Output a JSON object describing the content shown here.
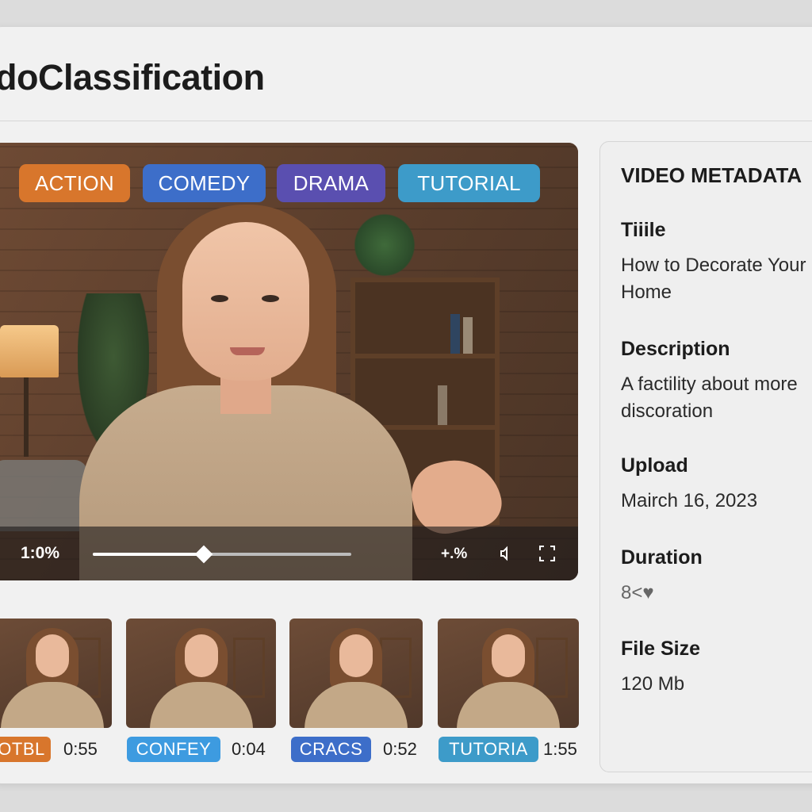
{
  "app": {
    "title": "doClassification"
  },
  "player": {
    "tags": [
      {
        "label": "ACTION",
        "color": "#d8762c"
      },
      {
        "label": "COMEDY",
        "color": "#3d6ec9"
      },
      {
        "label": "DRAMA",
        "color": "#5a4fb0"
      },
      {
        "label": "TUTORIAL",
        "color": "#3d9bc9"
      }
    ],
    "time": "1:0%",
    "progress": 0.43,
    "speed_label": "+.%",
    "volume_icon": "volume-icon",
    "fullscreen_icon": "fullscreen-icon"
  },
  "thumbnails": [
    {
      "tag": "OTBL",
      "duration": "0:55",
      "color": "#d8762c"
    },
    {
      "tag": "CONFEY",
      "duration": "0:04",
      "color": "#3d9be0"
    },
    {
      "tag": "CRACS",
      "duration": "0:52",
      "color": "#3d6ec9"
    },
    {
      "tag": "TUTORIA",
      "duration": "1:55",
      "color": "#3d9bc9"
    }
  ],
  "metadata": {
    "heading": "VIDEO METADATA",
    "title_label": "Tiiile",
    "title_value": "How to Decorate Your Home",
    "description_label": "Description",
    "description_value": "A factility about more discoration",
    "upload_label": "Upload",
    "upload_value": "Mairch 16, 2023",
    "duration_label": "Duration",
    "duration_value": "8<♥",
    "filesize_label": "File Size",
    "filesize_value": "120 Mb"
  }
}
